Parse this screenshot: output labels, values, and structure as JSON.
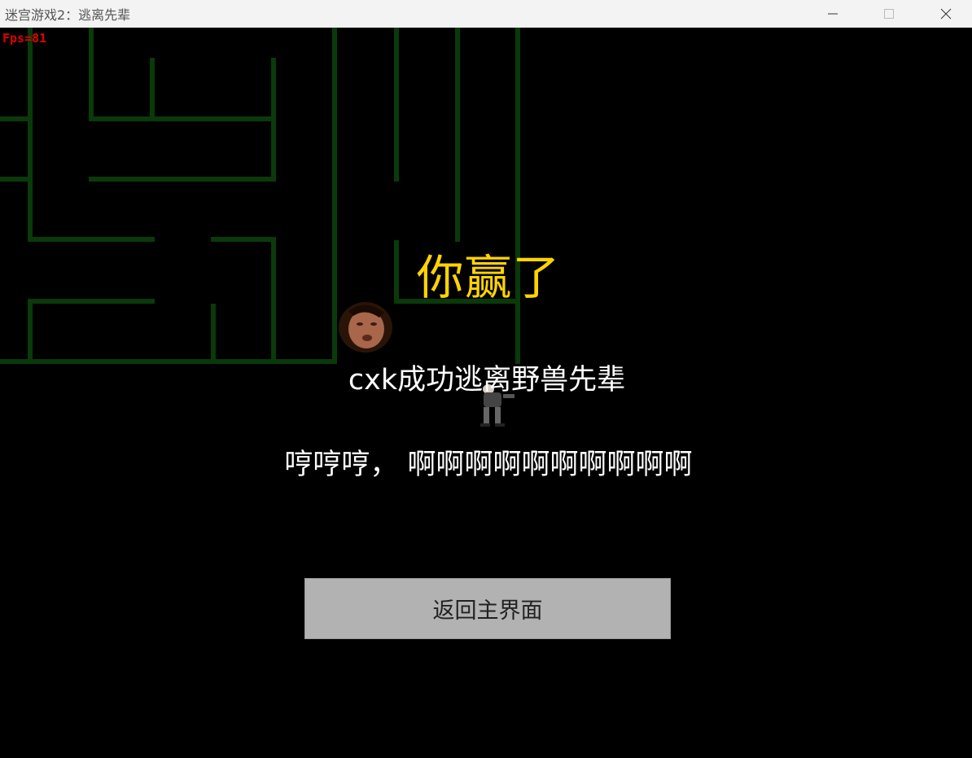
{
  "window": {
    "title": "迷宫游戏2：逃离先辈",
    "buttons": [
      "minimize-icon",
      "maximize-icon",
      "close-icon"
    ]
  },
  "hud": {
    "fps": "Fps=81"
  },
  "overlay": {
    "title": "你赢了",
    "message": "cxk成功逃离野兽先辈",
    "subtext": "哼哼哼， 啊啊啊啊啊啊啊啊啊啊",
    "back_button": "返回主界面"
  },
  "colors": {
    "background": "#000000",
    "maze_wall": "#0a3a0a",
    "title": "#ffd400",
    "fps": "#e00000",
    "button_bg": "#b2b2b2"
  }
}
